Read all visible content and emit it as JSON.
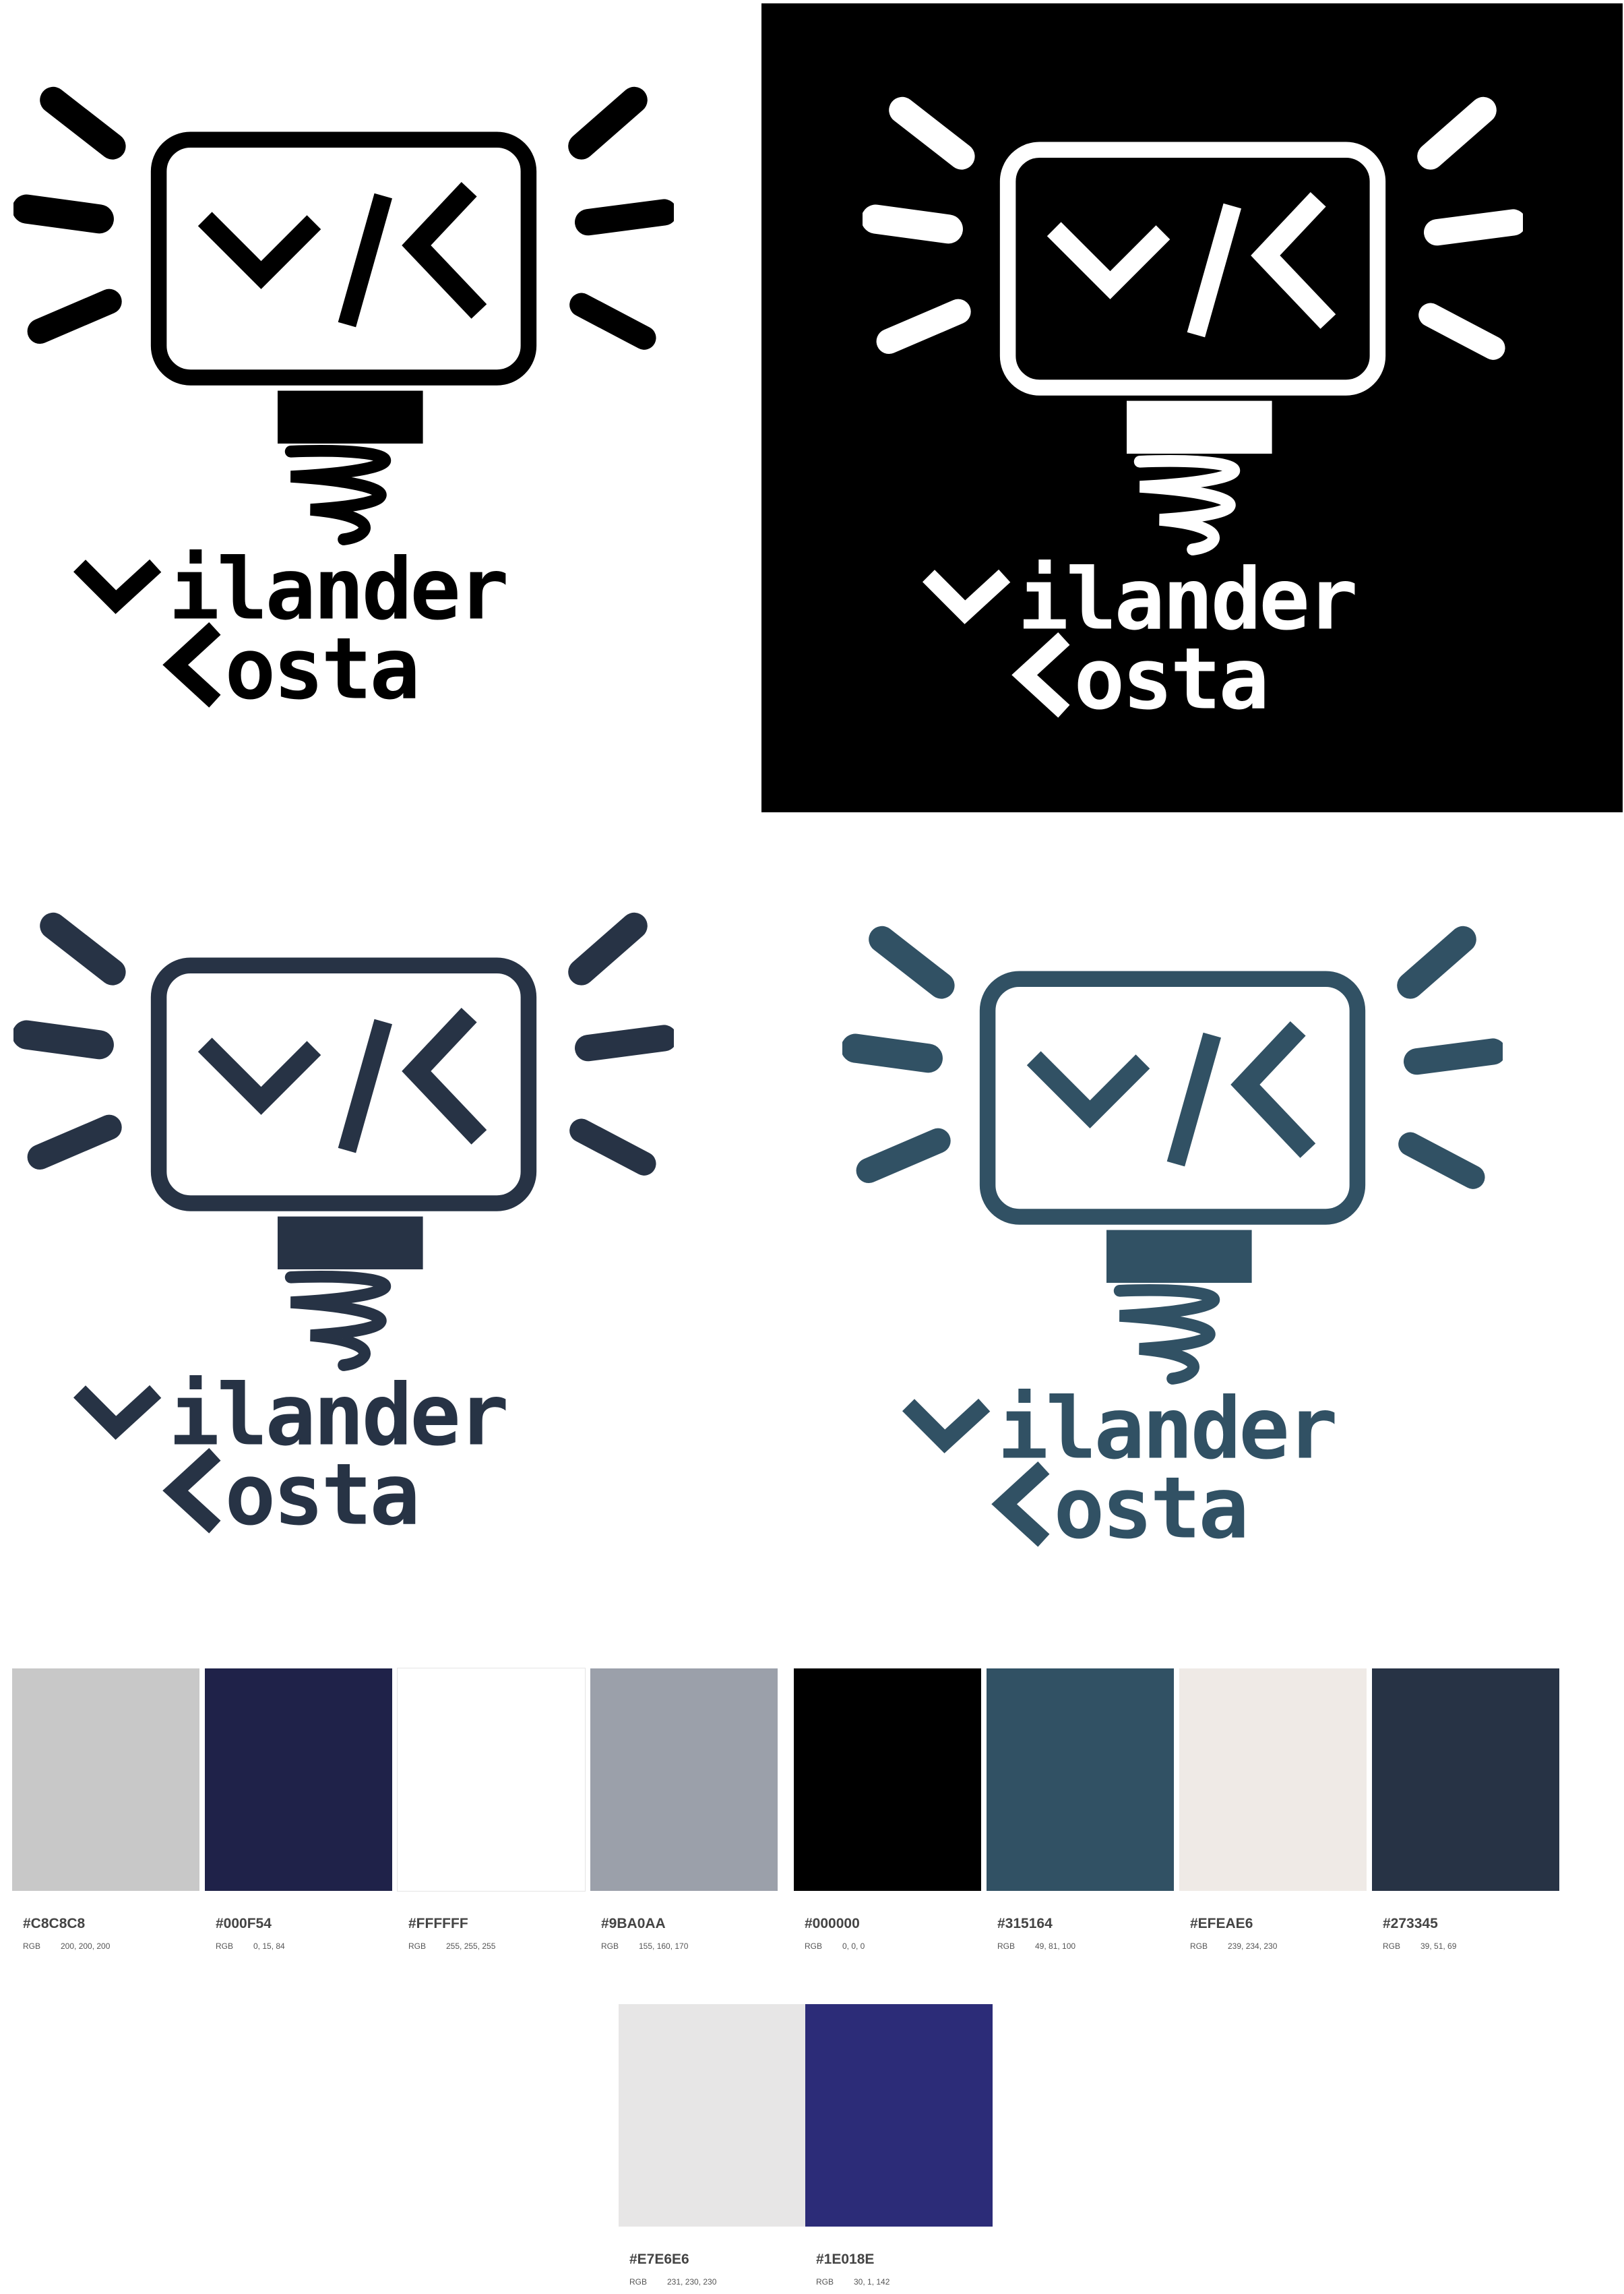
{
  "logo": {
    "mark": "v/<",
    "line1": "ilander",
    "line2": "osta",
    "variants": [
      {
        "name": "black-on-white",
        "fg": "#000000",
        "bg": "#ffffff"
      },
      {
        "name": "white-on-black",
        "fg": "#ffffff",
        "bg": "#000000"
      },
      {
        "name": "navy-on-white",
        "fg": "#273345",
        "bg": "#ffffff"
      },
      {
        "name": "teal-on-white",
        "fg": "#315164",
        "bg": "#ffffff"
      }
    ]
  },
  "palette": {
    "rgb_label": "RGB",
    "swatches": [
      {
        "hex": "#C8C8C8",
        "rgb": "200, 200, 200",
        "color": "#C8C8C8"
      },
      {
        "hex": "#000F54",
        "rgb": "0, 15, 84",
        "color": "#1f2249"
      },
      {
        "hex": "#FFFFFF",
        "rgb": "255, 255, 255",
        "color": "#FFFFFF"
      },
      {
        "hex": "#9BA0AA",
        "rgb": "155, 160, 170",
        "color": "#9BA0AA"
      },
      {
        "hex": "#000000",
        "rgb": "0, 0, 0",
        "color": "#000000"
      },
      {
        "hex": "#315164",
        "rgb": "49, 81, 100",
        "color": "#315164"
      },
      {
        "hex": "#EFEAE6",
        "rgb": "239, 234, 230",
        "color": "#EFEAE6"
      },
      {
        "hex": "#273345",
        "rgb": "39, 51, 69",
        "color": "#273345"
      },
      {
        "hex": "#E7E6E6",
        "rgb": "231, 230, 230",
        "color": "#E7E6E6"
      },
      {
        "hex": "#1E018E",
        "rgb": "30, 1, 142",
        "color": "#2c2c78"
      }
    ]
  }
}
